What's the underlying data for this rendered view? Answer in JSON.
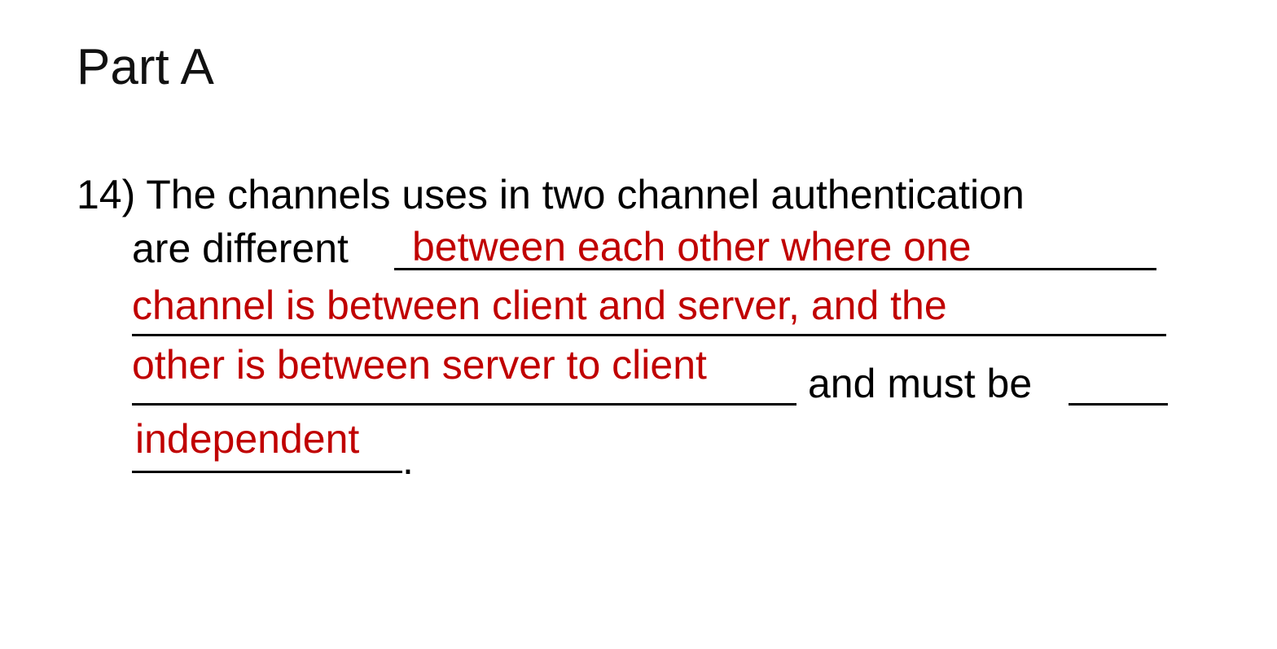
{
  "slide": {
    "title": "Part A",
    "question": {
      "line1": "14) The channels uses in two channel authentication",
      "prefix": "are different",
      "answer_line1": "between each other where one",
      "answer_line2": "channel is between client and server, and the",
      "answer_line3": "other is between server to client",
      "middle": "and must be",
      "answer2": "independent",
      "end": "."
    }
  },
  "colors": {
    "text": "#000000",
    "answer": "#c00000"
  }
}
